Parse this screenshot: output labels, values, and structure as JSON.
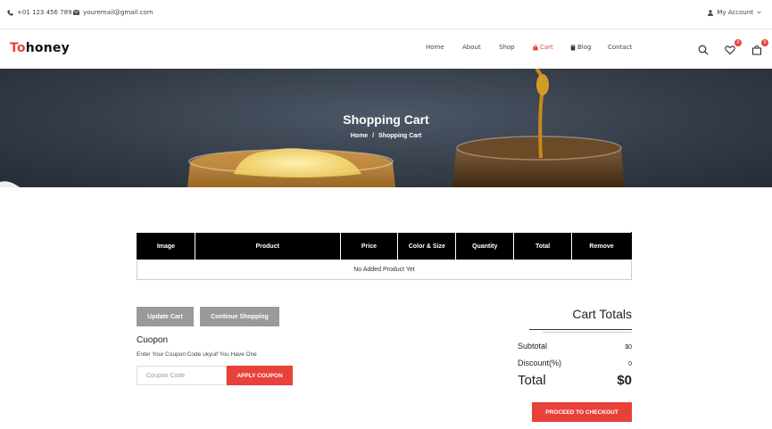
{
  "topbar": {
    "phone": "+01 123 456 789",
    "email": "youremail@gmail.com",
    "account": "My Account"
  },
  "header": {
    "logo_accent": "To",
    "logo_rest": "honey",
    "nav": {
      "home": "Home",
      "about": "About",
      "shop": "Shop",
      "cart": "Cart",
      "blog": "Blog",
      "contact": "Contact"
    },
    "wishlist_count": "0",
    "cart_count": "0"
  },
  "banner": {
    "title": "Shopping Cart",
    "breadcrumb_home": "Home",
    "breadcrumb_sep": "/",
    "breadcrumb_current": "Shopping Cart"
  },
  "cart_table": {
    "columns": [
      "Image",
      "Product",
      "Price",
      "Color & Size",
      "Quantity",
      "Total",
      "Remove"
    ],
    "empty_message": "No Added Product Yet"
  },
  "actions": {
    "update_cart": "Update Cart",
    "continue_shopping": "Continue Shopping"
  },
  "coupon": {
    "title": "Cuopon",
    "description": "Enter Your Coupon Code ukyuif You Have One",
    "placeholder": "Coupon Code",
    "apply": "APPLY COUPON"
  },
  "totals": {
    "title": "Cart Totals",
    "subtotal_label": "Subtotal",
    "subtotal_value": "$0",
    "discount_label": "Discount(%)",
    "discount_value": "0",
    "total_label": "Total",
    "total_value": "$0",
    "checkout": "PROCEED TO CHECKOUT"
  },
  "colors": {
    "accent": "#e8413a",
    "table_header": "#000000",
    "button_grey": "#9a9a9a"
  }
}
